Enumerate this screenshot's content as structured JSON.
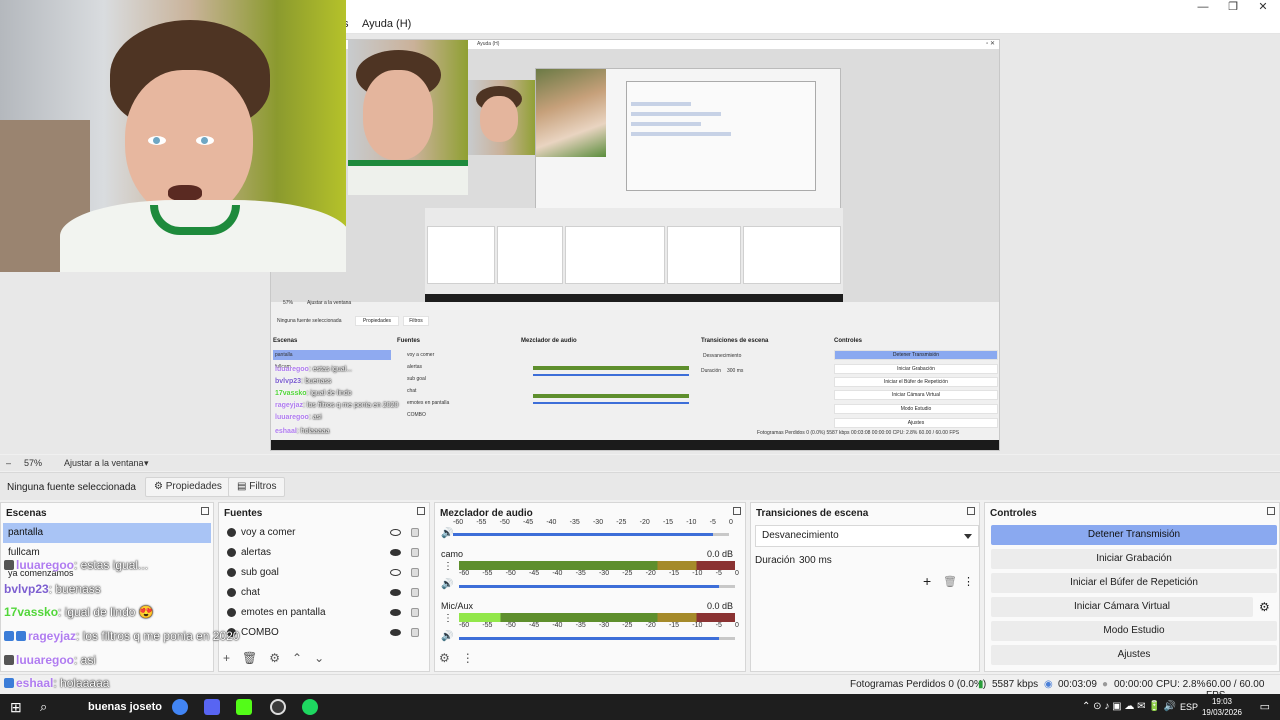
{
  "menu": {
    "partial": "s",
    "help": "Ayuda (H)"
  },
  "window_controls": {
    "minimize": "—",
    "maximize": "❐",
    "close": "✕"
  },
  "preview": {
    "inner_title": "Ayuda (H)",
    "mini_zoom": "57%",
    "mini_fit": "Ajustar a la ventana",
    "mini_no_source": "Ninguna fuente seleccionada",
    "mini_props": "Propiedades",
    "mini_filters": "Filtros",
    "mini_panels": [
      "Escenas",
      "Fuentes",
      "Mezclador de audio",
      "Transiciones de escena",
      "Controles"
    ],
    "mini_scenes": [
      "pantalla",
      "fullcam"
    ],
    "mini_sources": [
      "voy a comer",
      "alertas",
      "sub goal",
      "chat",
      "emotes en pantalla",
      "COMBO"
    ],
    "mini_transition": "Desvanecimiento",
    "mini_duration_label": "Duración",
    "mini_duration": "300 ms",
    "mini_controls": [
      "Detener Transmisión",
      "Iniciar Grabación",
      "Iniciar el Búfer de Repetición",
      "Iniciar Cámara Virtual",
      "Modo Estudio",
      "Ajustes"
    ],
    "mini_status": "Fotogramas Perdidos 0 (0.0%)   5587 kbps   00:03:08   00:00:00   CPU: 2.8%   60.00 / 60.00 FPS",
    "mini_chat": [
      {
        "user": "luuaregoo",
        "msg": ": estas igual...",
        "color": "#b07cf0"
      },
      {
        "user": "bvlvp23",
        "msg": ": buenass",
        "color": "#7d5fd0"
      },
      {
        "user": "17vassko",
        "msg": ": igual de lindo",
        "color": "#52d63a"
      },
      {
        "user": "rageyjaz",
        "msg": ": los filtros q me ponia en 2020",
        "color": "#b07cf0"
      },
      {
        "user": "luuaregoo",
        "msg": ": asi",
        "color": "#b07cf0"
      },
      {
        "user": "eshaal",
        "msg": ": holaaaaa",
        "color": "#b07cf0"
      }
    ]
  },
  "zoom": {
    "percent": "57%",
    "fit": "Ajustar a la ventana"
  },
  "source_bar": {
    "no_source": "Ninguna fuente seleccionada",
    "properties": "Propiedades",
    "filters": "Filtros"
  },
  "scenes": {
    "title": "Escenas",
    "items": [
      "pantalla",
      "fullcam",
      "ya comenzamos"
    ],
    "selected": "pantalla"
  },
  "sources": {
    "title": "Fuentes",
    "items": [
      {
        "label": "voy a comer",
        "visible": false
      },
      {
        "label": "alertas",
        "visible": true
      },
      {
        "label": "sub goal",
        "visible": false
      },
      {
        "label": "chat",
        "visible": true
      },
      {
        "label": "emotes en pantalla",
        "visible": true
      },
      {
        "label": "COMBO",
        "visible": true
      }
    ]
  },
  "mixer": {
    "title": "Mezclador de audio",
    "ticks": [
      "-60",
      "-55",
      "-50",
      "-45",
      "-40",
      "-35",
      "-30",
      "-25",
      "-20",
      "-15",
      "-10",
      "-5",
      "0"
    ],
    "channels": [
      {
        "name": "camo",
        "db": "0.0 dB",
        "level": 0.0
      },
      {
        "name": "Mic/Aux",
        "db": "0.0 dB",
        "level": 0.15
      }
    ]
  },
  "transitions": {
    "title": "Transiciones de escena",
    "selected": "Desvanecimiento",
    "duration_label": "Duración",
    "duration": "300 ms"
  },
  "controls": {
    "title": "Controles",
    "buttons": [
      "Detener Transmisión",
      "Iniciar Grabación",
      "Iniciar el Búfer de Repetición",
      "Iniciar Cámara Virtual",
      "Modo Estudio",
      "Ajustes"
    ]
  },
  "status": {
    "dropped": "Fotogramas Perdidos 0 (0.0%)",
    "bitrate": "5587 kbps",
    "live_time": "00:03:09",
    "rec_time": "00:00:00",
    "cpu": "CPU: 2.8%",
    "fps": "60.00 / 60.00 FPS"
  },
  "chat": [
    {
      "user": "luuaregoo",
      "msg": ": estas igual...",
      "color": "#b07cf0"
    },
    {
      "user": "bvlvp23",
      "msg": ": buenass",
      "color": "#7d5fd0"
    },
    {
      "user": "17vassko",
      "msg": ": igual de lindo 😍",
      "color": "#52d63a"
    },
    {
      "user": "rageyjaz",
      "msg": ": los filtros q me ponia en 2020",
      "color": "#b07cf0"
    },
    {
      "user": "luuaregoo",
      "msg": ": asi",
      "color": "#b07cf0"
    },
    {
      "user": "eshaal",
      "msg": ": holaaaaa",
      "color": "#b07cf0"
    }
  ],
  "taskbar": {
    "search_text": "buenas joseto",
    "language": "ESP",
    "time": "19:03",
    "date": "19/03/2026",
    "app_icons": [
      "windows-icon",
      "search-icon",
      "browser-icon",
      "chrome-icon",
      "discord-icon",
      "kick-icon",
      "obs-icon",
      "spotify-icon"
    ],
    "colors": {
      "kick": "#53fc18",
      "spotify": "#1ed760",
      "chrome": "#4285f4"
    }
  },
  "colors": {
    "accent": "#8aa9f0",
    "selected_scene": "#a9c4f5",
    "slider": "#3d6ed8"
  }
}
